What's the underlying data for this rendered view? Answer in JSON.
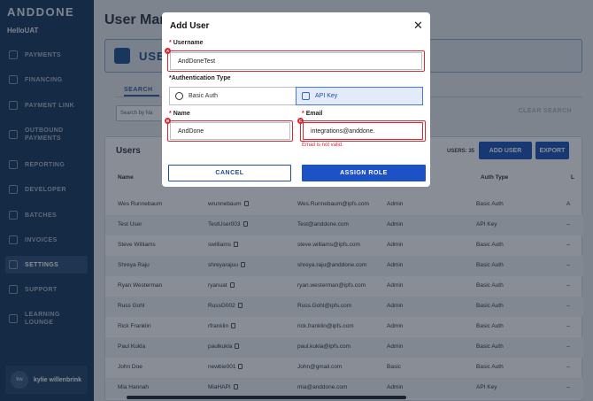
{
  "brand": "ANDDONE",
  "org": "HelloUAT",
  "nav": [
    {
      "label": "PAYMENTS",
      "icon": "payments-icon"
    },
    {
      "label": "FINANCING",
      "icon": "financing-icon"
    },
    {
      "label": "PAYMENT LINK",
      "icon": "payment-link-icon"
    },
    {
      "label": "OUTBOUND PAYMENTS",
      "icon": "outbound-payments-icon"
    },
    {
      "label": "REPORTING",
      "icon": "reporting-icon"
    },
    {
      "label": "DEVELOPER",
      "icon": "developer-icon"
    },
    {
      "label": "BATCHES",
      "icon": "batches-icon"
    },
    {
      "label": "INVOICES",
      "icon": "invoices-icon"
    },
    {
      "label": "SETTINGS",
      "icon": "gear-icon"
    },
    {
      "label": "SUPPORT",
      "icon": "support-icon"
    },
    {
      "label": "LEARNING LOUNGE",
      "icon": "learning-icon"
    }
  ],
  "user": {
    "initials": "kw",
    "name": "kylie willenbrink"
  },
  "page": {
    "title": "User Man",
    "banner": "USE",
    "search_tab": "SEARCH",
    "search_placeholder": "Search by Na",
    "clear_search": "CLEAR SEARCH"
  },
  "users": {
    "title": "Users",
    "count": "USERS: 35",
    "add_user": "ADD USER",
    "export": "EXPORT",
    "headers": {
      "name": "Name",
      "auth": "Auth Type",
      "last": "L"
    },
    "rows": [
      {
        "name": "Wes Runnebaum",
        "username": "wrunnebaum",
        "email": "Wes.Runnebaum@ipfs.com",
        "role": "Admin",
        "auth": "Basic Auth",
        "last": "A"
      },
      {
        "name": "Test User",
        "username": "TestUser003",
        "email": "Test@anddone.com",
        "role": "Admin",
        "auth": "API Key",
        "last": "--"
      },
      {
        "name": "Steve Williams",
        "username": "swilliams",
        "email": "steve.williams@ipfs.com",
        "role": "Admin",
        "auth": "Basic Auth",
        "last": "--"
      },
      {
        "name": "Shreya Raju",
        "username": "shreyarajuu",
        "email": "shreya.raju@anddone.com",
        "role": "Admin",
        "auth": "Basic Auth",
        "last": "--"
      },
      {
        "name": "Ryan Westerman",
        "username": "ryanuat",
        "email": "ryan.westerman@ipfs.com",
        "role": "Admin",
        "auth": "Basic Auth",
        "last": "--"
      },
      {
        "name": "Russ Gohl",
        "username": "RussG002",
        "email": "Russ.Gohl@ipfs.com",
        "role": "Admin",
        "auth": "Basic Auth",
        "last": "--"
      },
      {
        "name": "Rick Franklin",
        "username": "rfranklin",
        "email": "rick.franklin@ipfs.com",
        "role": "Admin",
        "auth": "Basic Auth",
        "last": "--"
      },
      {
        "name": "Paul Kukla",
        "username": "paulkukla",
        "email": "paul.kukla@ipfs.com",
        "role": "Admin",
        "auth": "Basic Auth",
        "last": "--"
      },
      {
        "name": "John Doe",
        "username": "newbie001",
        "email": "John@gmail.com",
        "role": "Basic",
        "auth": "Basic Auth",
        "last": "--"
      },
      {
        "name": "Mia Hannah",
        "username": "MiaHAPI",
        "email": "mia@anddone.com",
        "role": "Admin",
        "auth": "API Key",
        "last": "--"
      }
    ]
  },
  "modal": {
    "title": "Add User",
    "username_label": "Username",
    "username_value": "AndDoneTest",
    "auth_type_label": "*Authentication Type",
    "auth_basic": "Basic Auth",
    "auth_api": "API Key",
    "name_label": "Name",
    "name_value": "AndDone",
    "email_label": "Email",
    "email_value": "integrations@anddone.",
    "email_error": "Email is not valid.",
    "cancel": "CANCEL",
    "assign_role": "ASSIGN ROLE",
    "markers": {
      "a": "A",
      "b": "B",
      "c": "C"
    },
    "required_mark": "*"
  }
}
